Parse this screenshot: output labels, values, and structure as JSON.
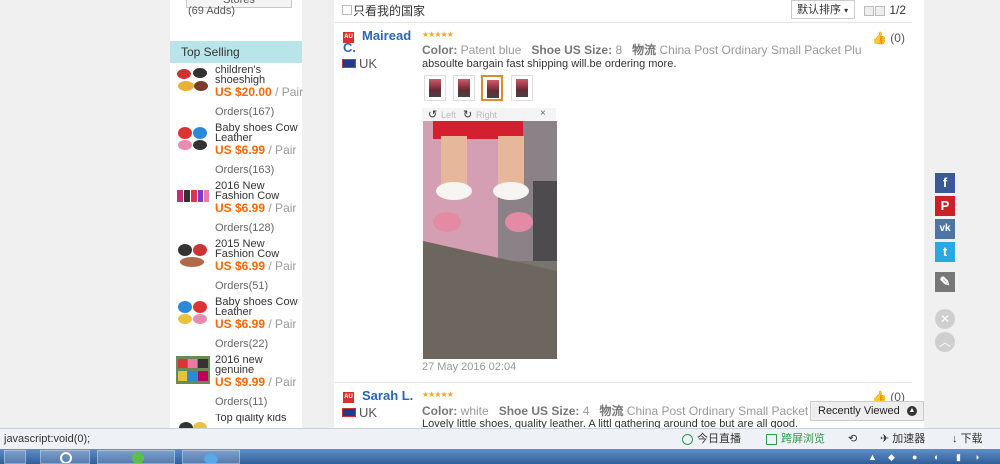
{
  "sidebar": {
    "stores_button": "Stores",
    "adds_text": "(69 Adds)",
    "top_selling_title": "Top Selling",
    "items": [
      {
        "title": "children's shoeshigh",
        "price": "US $20.00",
        "unit": "/ Pair",
        "orders": "Orders(167)"
      },
      {
        "title": "Baby shoes Cow Leather",
        "price": "US $6.99",
        "unit": "/ Pair",
        "orders": "Orders(163)"
      },
      {
        "title": "2016 New Fashion Cow",
        "price": "US $6.99",
        "unit": "/ Pair",
        "orders": "Orders(128)"
      },
      {
        "title": "2015 New Fashion Cow",
        "price": "US $6.99",
        "unit": "/ Pair",
        "orders": "Orders(51)"
      },
      {
        "title": "Baby shoes Cow Leather",
        "price": "US $6.99",
        "unit": "/ Pair",
        "orders": "Orders(22)"
      },
      {
        "title": "2016 new genuine",
        "price": "US $9.99",
        "unit": "/ Pair",
        "orders": "Orders(11)"
      },
      {
        "title": "Top qiality kids",
        "price": "",
        "unit": "",
        "orders": ""
      }
    ]
  },
  "filter": {
    "only_my_country": "只看我的国家",
    "sort_label": "默认排序",
    "page": "1/2"
  },
  "reviews": [
    {
      "name_line1": "Mairead",
      "name_line2": "C.",
      "country": "UK",
      "stars": "★★★★★",
      "color_label": "Color:",
      "color_value": "Patent blue",
      "size_label": "Shoe US Size:",
      "size_value": "8",
      "shipping_label": "物流",
      "shipping_value": "China Post Ordinary Small Packet Plus",
      "text": "absoulte bargain fast shipping will.be ordering more.",
      "likes": "(0)",
      "viewer_left": "Left",
      "viewer_right": "Right",
      "date": "27 May 2016 02:04"
    },
    {
      "name_line1": "Sarah L.",
      "country": "UK",
      "stars": "★★★★★",
      "color_label": "Color:",
      "color_value": "white",
      "size_label": "Shoe US Size:",
      "size_value": "4",
      "shipping_label": "物流",
      "shipping_value": "China Post Ordinary Small Packet P",
      "text": "Lovely little shoes, quality leather. A littl gathering around toe but are all good.",
      "likes": "(0)"
    }
  ],
  "recently_viewed": "Recently Viewed",
  "statusbar": {
    "url": "javascript:void(0);",
    "today_live": "今日直播",
    "cross_screen": "跨屏浏览",
    "accelerator": "加速器",
    "download": "下载"
  },
  "colors": {
    "link_blue": "#2a66b2",
    "price_orange": "#ff6600",
    "top_selling_bg": "#b8e4ea",
    "star_gold": "#f5a623"
  }
}
